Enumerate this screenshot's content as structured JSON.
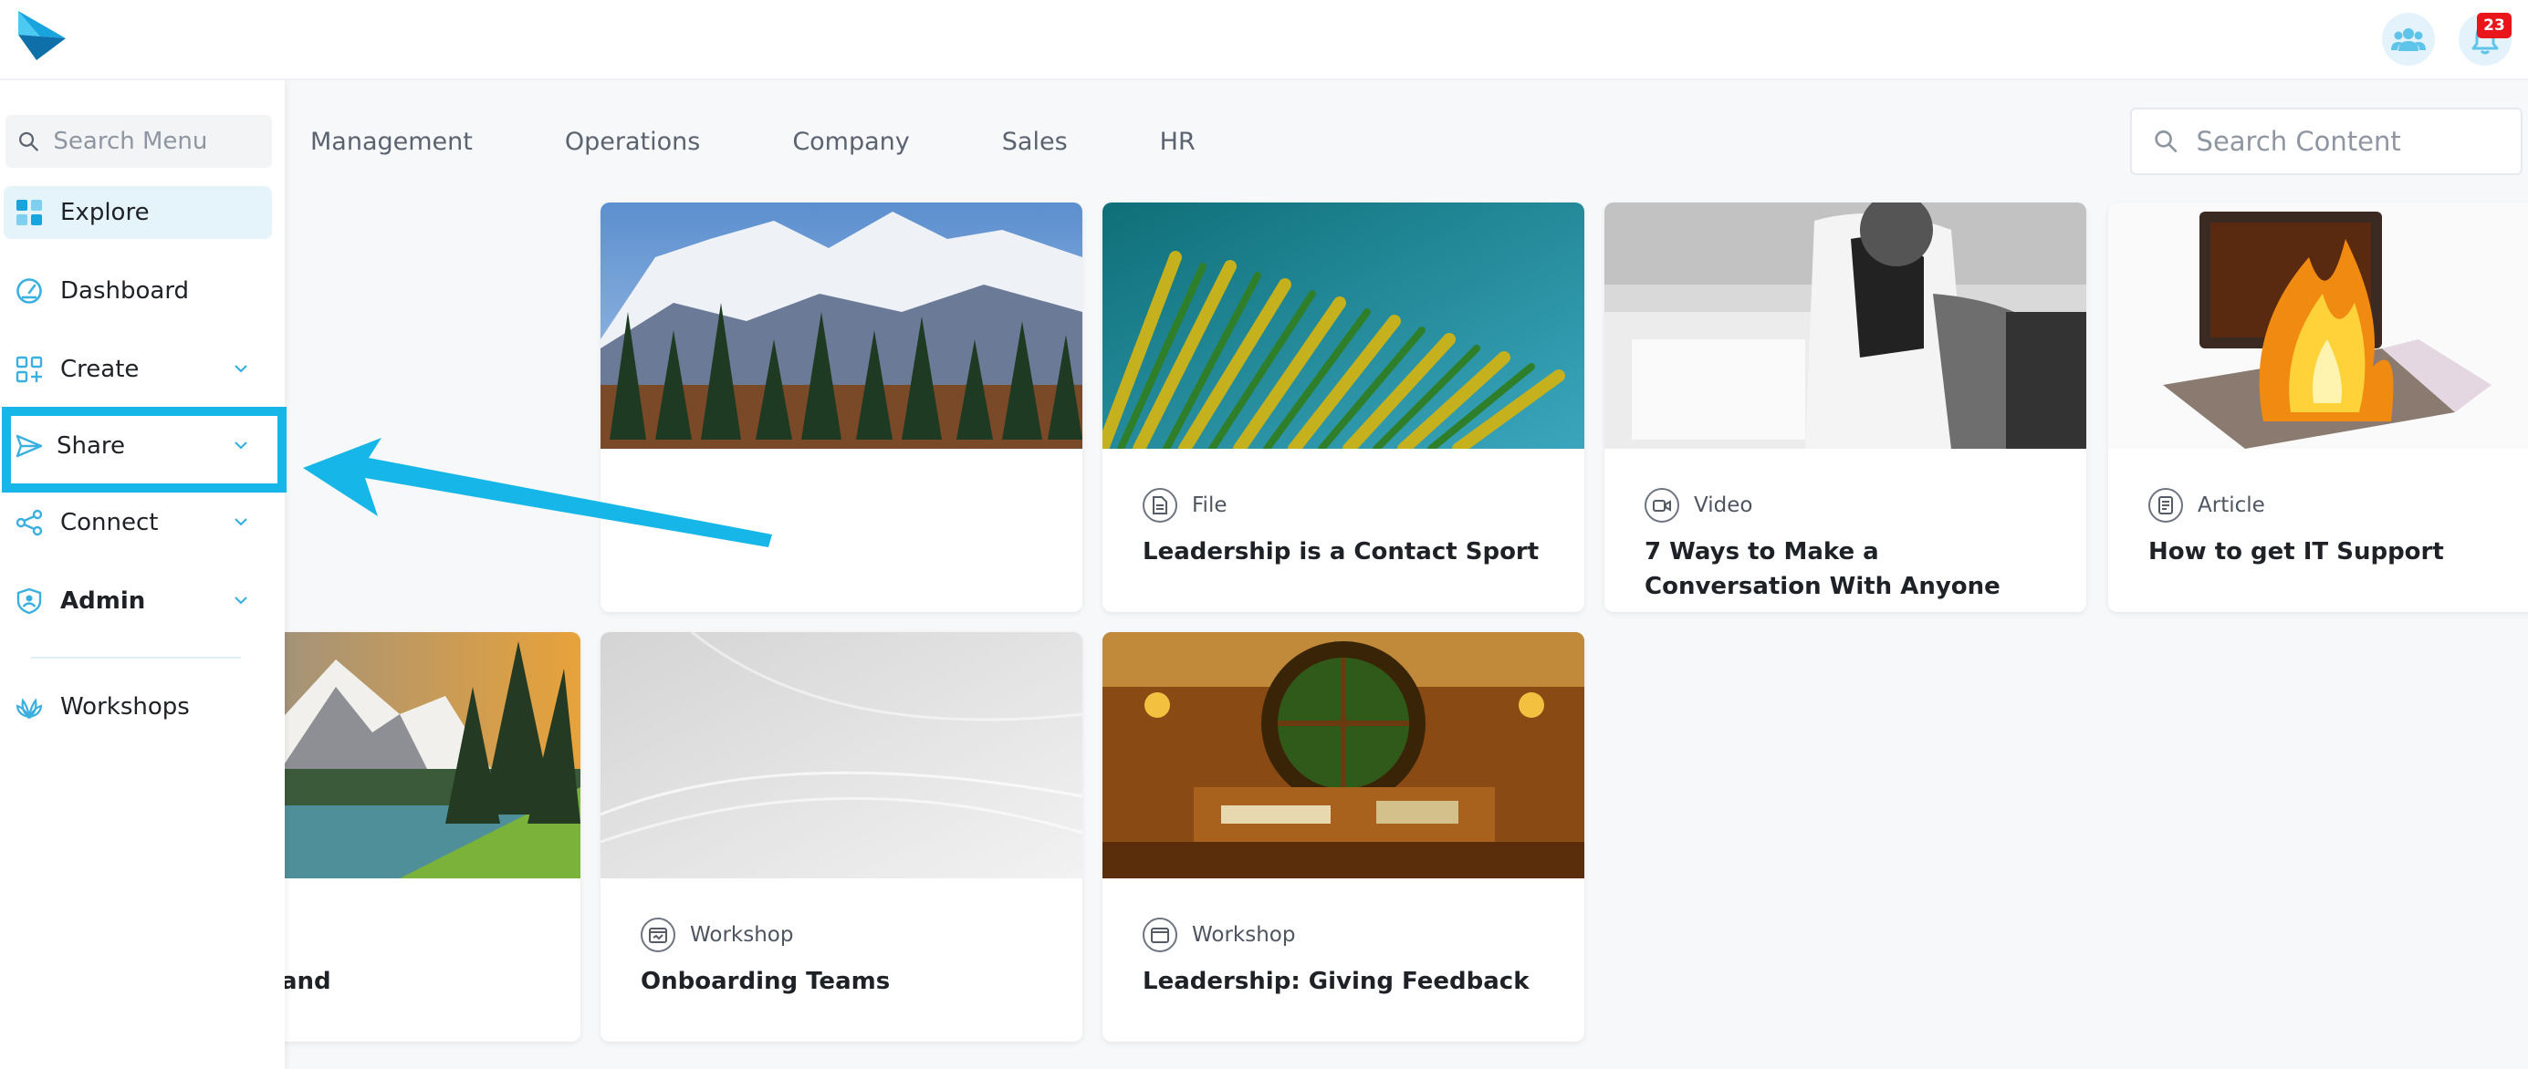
{
  "header": {
    "logo_icon": "paper-plane-logo",
    "team_icon": "team-icon",
    "bell_icon": "bell-icon",
    "notification_count": "23",
    "accent_color": "#16b7e8",
    "badge_color": "#e8151b"
  },
  "sidebar": {
    "search_placeholder": "Search Menu",
    "items": [
      {
        "label": "Explore",
        "icon": "grid-icon",
        "active": true,
        "has_chevron": false
      },
      {
        "label": "Dashboard",
        "icon": "gauge-icon",
        "has_chevron": false
      },
      {
        "label": "Create",
        "icon": "add-grid-icon",
        "has_chevron": true
      },
      {
        "label": "Share",
        "icon": "send-icon",
        "has_chevron": true,
        "highlighted": true
      },
      {
        "label": "Connect",
        "icon": "share-nodes-icon",
        "has_chevron": true
      },
      {
        "label": "Admin",
        "icon": "shield-user-icon",
        "has_chevron": true,
        "bold": true
      },
      {
        "label": "Workshops",
        "icon": "lotus-icon",
        "has_chevron": false
      }
    ]
  },
  "tabs": [
    "Management",
    "Operations",
    "Company",
    "Sales",
    "HR"
  ],
  "search_content": {
    "placeholder": "Search Content"
  },
  "cards": [
    {
      "type": "",
      "title": "",
      "image": "snowy-mountains-forest"
    },
    {
      "type": "File",
      "title": "Leadership is a Contact Sport",
      "image": "palm-leaf",
      "type_icon": "file-icon"
    },
    {
      "type": "Video",
      "title": "7 Ways to Make a Conversation With Anyone",
      "image": "woman-writing",
      "type_icon": "video-icon"
    },
    {
      "type": "Article",
      "title": "How to get IT Support",
      "image": "burning-laptop",
      "type_icon": "article-icon"
    },
    {
      "type": "",
      "title": "and",
      "image": "mountain-lake-painting"
    },
    {
      "type": "Workshop",
      "title": "Onboarding Teams",
      "image": "grey-waves",
      "type_icon": "workshop-icon"
    },
    {
      "type": "Workshop",
      "title": "Leadership: Giving Feedback",
      "image": "hobbit-room",
      "type_icon": "workshop-icon"
    }
  ],
  "annotation": {
    "highlight_color": "#16b7e8",
    "arrow_icon": "pointer-arrow"
  }
}
